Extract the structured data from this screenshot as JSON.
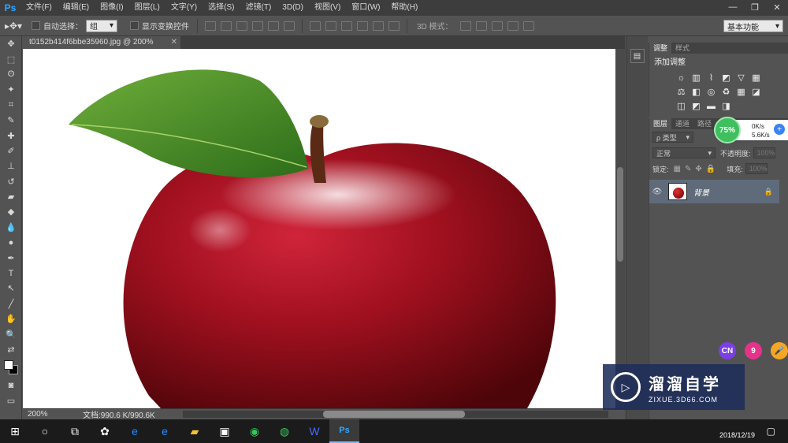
{
  "app": {
    "logo": "Ps"
  },
  "menu": [
    "文件(F)",
    "编辑(E)",
    "图像(I)",
    "图层(L)",
    "文字(Y)",
    "选择(S)",
    "滤镜(T)",
    "3D(D)",
    "视图(V)",
    "窗口(W)",
    "帮助(H)"
  ],
  "window_controls": [
    "—",
    "❐",
    "✕"
  ],
  "options": {
    "auto_select_label": "自动选择：",
    "auto_select_value": "组",
    "show_transform_label": "显示变换控件",
    "mode_3d_label": "3D 模式：",
    "workspace": "基本功能"
  },
  "document": {
    "tab_title": "t0152b414f6bbe35960.jpg @ 200%(RGB/8#)",
    "zoom": "200%",
    "doc_info": "文档:990.6 K/990.6K"
  },
  "panels": {
    "adjust_tabs": [
      "调整",
      "样式"
    ],
    "adjust_title": "添加调整",
    "layers_tabs": [
      "图层",
      "通道",
      "路径"
    ],
    "filter_label": "ρ 类型",
    "blend_mode": "正常",
    "opacity_label": "不透明度:",
    "opacity_value": "100%",
    "lock_label": "锁定:",
    "fill_label": "填充:",
    "fill_value": "100%",
    "layer_name": "背景"
  },
  "network_widget": {
    "percent": "75%",
    "up": "0K/s",
    "down": "5.6K/s"
  },
  "float_buttons": [
    {
      "label": "CN",
      "color": "#7b3fe4"
    },
    {
      "label": "9",
      "color": "#e5338a"
    },
    {
      "label": "🎤",
      "color": "#f5a623"
    }
  ],
  "watermark": {
    "brand": "溜溜自学",
    "url": "ZIXUE.3D66.COM"
  },
  "taskbar": {
    "date": "2018/12/19"
  }
}
